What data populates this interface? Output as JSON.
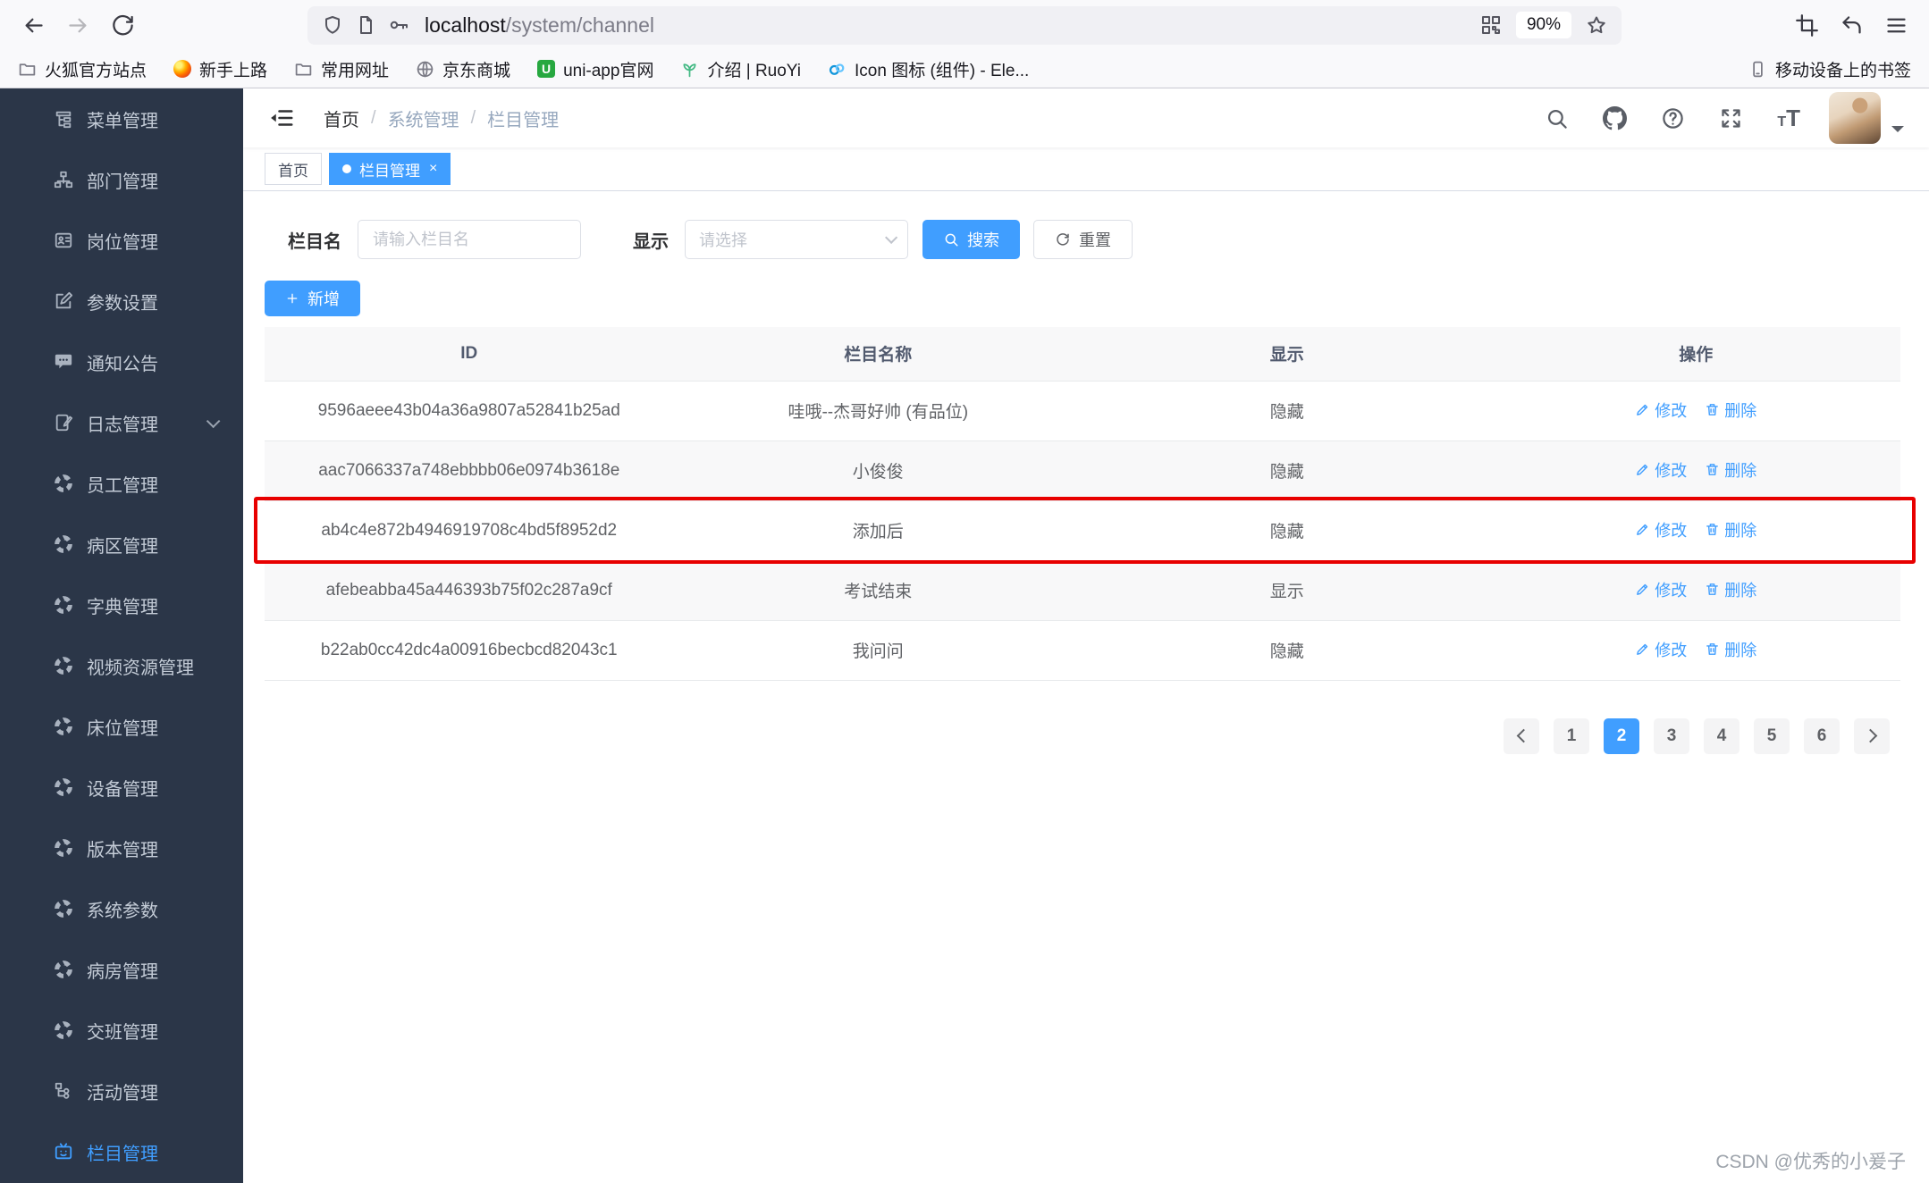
{
  "browser": {
    "url_host": "localhost",
    "url_path": "/system/channel",
    "zoom_level": "90%",
    "bookmarks": [
      {
        "key": "firefox-official",
        "label": "火狐官方站点",
        "icon": "folder-icon"
      },
      {
        "key": "getting-started",
        "label": "新手上路",
        "icon": "firefox-icon"
      },
      {
        "key": "common-sites",
        "label": "常用网址",
        "icon": "folder-icon"
      },
      {
        "key": "jd-mall",
        "label": "京东商城",
        "icon": "globe-icon"
      },
      {
        "key": "uniapp-site",
        "label": "uni-app官网",
        "icon": "uniapp-icon"
      },
      {
        "key": "ruoyi-intro",
        "label": "介绍 | RuoYi",
        "icon": "plant-icon"
      },
      {
        "key": "element-icons",
        "label": "Icon 图标 (组件) - Ele...",
        "icon": "element-icon"
      }
    ],
    "bookmarks_right": {
      "key": "mobile-bookmarks",
      "label": "移动设备上的书签",
      "icon": "mobile-icon"
    }
  },
  "sidebar": {
    "items": [
      {
        "key": "menu-management",
        "label": "菜单管理",
        "icon": "tree-table-icon"
      },
      {
        "key": "dept-management",
        "label": "部门管理",
        "icon": "org-icon"
      },
      {
        "key": "post-management",
        "label": "岗位管理",
        "icon": "postcard-icon"
      },
      {
        "key": "param-settings",
        "label": "参数设置",
        "icon": "edit-icon"
      },
      {
        "key": "notice-management",
        "label": "通知公告",
        "icon": "message-icon"
      },
      {
        "key": "log-management",
        "label": "日志管理",
        "icon": "log-icon",
        "expandable": true
      },
      {
        "key": "staff-management",
        "label": "员工管理",
        "icon": "guide-icon"
      },
      {
        "key": "ward-area-management",
        "label": "病区管理",
        "icon": "guide-icon"
      },
      {
        "key": "dict-management",
        "label": "字典管理",
        "icon": "guide-icon"
      },
      {
        "key": "video-resource-management",
        "label": "视频资源管理",
        "icon": "guide-icon"
      },
      {
        "key": "bed-management",
        "label": "床位管理",
        "icon": "guide-icon"
      },
      {
        "key": "device-management",
        "label": "设备管理",
        "icon": "guide-icon"
      },
      {
        "key": "version-management",
        "label": "版本管理",
        "icon": "guide-icon"
      },
      {
        "key": "system-params",
        "label": "系统参数",
        "icon": "guide-icon"
      },
      {
        "key": "room-management",
        "label": "病房管理",
        "icon": "guide-icon"
      },
      {
        "key": "shift-management",
        "label": "交班管理",
        "icon": "guide-icon"
      },
      {
        "key": "activity-management",
        "label": "活动管理",
        "icon": "tree-icon"
      },
      {
        "key": "channel-management",
        "label": "栏目管理",
        "icon": "category-icon",
        "active": true
      }
    ]
  },
  "navbar": {
    "breadcrumb": [
      "首页",
      "系统管理",
      "栏目管理"
    ]
  },
  "tags": [
    {
      "key": "home",
      "label": "首页",
      "active": false,
      "closable": false
    },
    {
      "key": "channel-management",
      "label": "栏目管理",
      "active": true,
      "closable": true
    }
  ],
  "filters": {
    "name_label": "栏目名",
    "name_placeholder": "请输入栏目名",
    "display_label": "显示",
    "display_placeholder": "请选择",
    "search_label": "搜索",
    "reset_label": "重置"
  },
  "toolbar": {
    "add_label": "新增"
  },
  "table": {
    "columns": [
      "ID",
      "栏目名称",
      "显示",
      "操作"
    ],
    "action_labels": {
      "edit": "修改",
      "delete": "删除"
    },
    "rows": [
      {
        "id": "9596aeee43b04a36a9807a52841b25ad",
        "name": "哇哦--杰哥好帅 (有品位)",
        "display": "隐藏",
        "highlighted": false
      },
      {
        "id": "aac7066337a748ebbbb06e0974b3618e",
        "name": "小俊俊",
        "display": "隐藏",
        "highlighted": false
      },
      {
        "id": "ab4c4e872b4946919708c4bd5f8952d2",
        "name": "添加后",
        "display": "隐藏",
        "highlighted": true
      },
      {
        "id": "afebeabba45a446393b75f02c287a9cf",
        "name": "考试结束",
        "display": "显示",
        "highlighted": false
      },
      {
        "id": "b22ab0cc42dc4a00916becbcd82043c1",
        "name": "我问问",
        "display": "隐藏",
        "highlighted": false
      }
    ]
  },
  "pagination": {
    "pages": [
      1,
      2,
      3,
      4,
      5,
      6
    ],
    "current": 2
  },
  "watermark": "CSDN @优秀的小爰子",
  "colors": {
    "accent": "#409eff",
    "sidebar_bg": "#2b3648",
    "highlight_border": "#e80000",
    "chrome_bg": "#f9f9fb"
  }
}
